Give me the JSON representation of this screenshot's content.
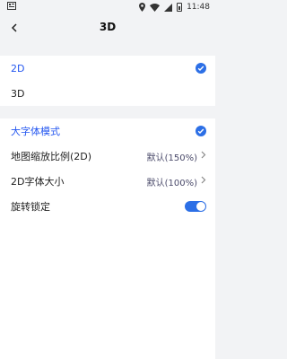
{
  "status_bar": {
    "left_icon": "sim-notification-icon",
    "time": "11:48",
    "icons": [
      "location-icon",
      "wifi-icon",
      "signal-icon",
      "battery-icon"
    ]
  },
  "app_bar": {
    "title": "3D",
    "back_icon": "chevron-left-icon"
  },
  "view_mode": {
    "options": [
      {
        "label": "2D",
        "selected": true
      },
      {
        "label": "3D",
        "selected": false
      }
    ]
  },
  "settings": {
    "large_font": {
      "label": "大字体模式",
      "checked": true
    },
    "map_zoom": {
      "label": "地图缩放比例(2D)",
      "value": "默认(150%)"
    },
    "font_size_2d": {
      "label": "2D字体大小",
      "value": "默认(100%)"
    },
    "rotation_lock": {
      "label": "旋转锁定",
      "on": true
    }
  },
  "colors": {
    "accent": "#2c6fe6",
    "selected_text": "#2356f0",
    "background": "#f2f3f5"
  }
}
